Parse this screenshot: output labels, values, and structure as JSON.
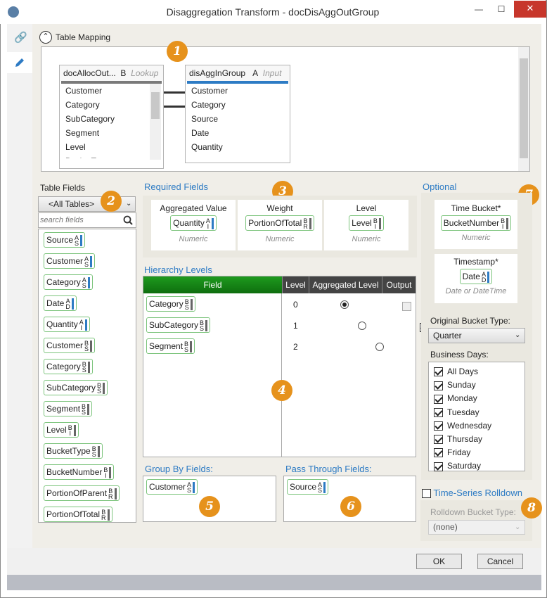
{
  "window": {
    "title": "Disaggregation Transform - docDisAggOutGroup",
    "min": "—",
    "max": "☐",
    "close": "✕"
  },
  "table_mapping": {
    "label": "Table Mapping",
    "left_table": {
      "name": "docAllocOut...",
      "key": "B",
      "role": "Lookup",
      "rows": [
        "Customer",
        "Category",
        "SubCategory",
        "Segment",
        "Level",
        "BucketT..."
      ]
    },
    "right_table": {
      "name": "disAggInGroup",
      "key": "A",
      "role": "Input",
      "rows": [
        "Customer",
        "Category",
        "Source",
        "Date",
        "Quantity"
      ]
    }
  },
  "badges": [
    "1",
    "2",
    "3",
    "4",
    "5",
    "6",
    "7",
    "8"
  ],
  "table_fields": {
    "label": "Table Fields",
    "dropdown": "<All Tables>",
    "search_placeholder": "search fields",
    "items": [
      {
        "name": "Source",
        "t": "A",
        "b": "S",
        "color": "#2d7bc4"
      },
      {
        "name": "Customer",
        "t": "A",
        "b": "S",
        "color": "#2d7bc4"
      },
      {
        "name": "Category",
        "t": "A",
        "b": "S",
        "color": "#2d7bc4"
      },
      {
        "name": "Date",
        "t": "A",
        "b": "D",
        "color": "#2d7bc4"
      },
      {
        "name": "Quantity",
        "t": "A",
        "b": "I",
        "color": "#2d7bc4"
      },
      {
        "name": "Customer",
        "t": "B",
        "b": "S",
        "color": "#666666"
      },
      {
        "name": "Category",
        "t": "B",
        "b": "S",
        "color": "#666666"
      },
      {
        "name": "SubCategory",
        "t": "B",
        "b": "S",
        "color": "#666666"
      },
      {
        "name": "Segment",
        "t": "B",
        "b": "S",
        "color": "#666666"
      },
      {
        "name": "Level",
        "t": "B",
        "b": "I",
        "color": "#666666"
      },
      {
        "name": "BucketType",
        "t": "B",
        "b": "S",
        "color": "#666666"
      },
      {
        "name": "BucketNumber",
        "t": "B",
        "b": "I",
        "color": "#666666"
      },
      {
        "name": "PortionOfParent",
        "t": "B",
        "b": "R",
        "color": "#666666"
      },
      {
        "name": "PortionOfTotal",
        "t": "B",
        "b": "R",
        "color": "#666666"
      }
    ]
  },
  "required": {
    "label": "Required Fields",
    "cols": [
      {
        "title": "Aggregated Value",
        "field": "Quantity",
        "t": "A",
        "b": "I",
        "type": "Numeric"
      },
      {
        "title": "Weight",
        "field": "PortionOfTotal",
        "t": "B",
        "b": "R",
        "type": "Numeric"
      },
      {
        "title": "Level",
        "field": "Level",
        "t": "B",
        "b": "I",
        "type": "Numeric"
      }
    ]
  },
  "hierarchy": {
    "label": "Hierarchy Levels",
    "headers": [
      "Field",
      "Level",
      "Aggregated Level",
      "Output"
    ],
    "rows": [
      {
        "field": "Category",
        "t": "B",
        "b": "S",
        "level": "0",
        "agg": true,
        "output": false
      },
      {
        "field": "SubCategory",
        "t": "B",
        "b": "S",
        "level": "1",
        "agg": false,
        "output": true
      },
      {
        "field": "Segment",
        "t": "B",
        "b": "S",
        "level": "2",
        "agg": false,
        "output": true
      }
    ]
  },
  "group_by": {
    "label": "Group By Fields:",
    "field": "Customer",
    "t": "A",
    "b": "S"
  },
  "pass_through": {
    "label": "Pass Through Fields:",
    "field": "Source",
    "t": "A",
    "b": "S"
  },
  "optional": {
    "label": "Optional",
    "time_bucket": {
      "title": "Time Bucket*",
      "field": "BucketNumber",
      "t": "B",
      "b": "I",
      "type": "Numeric"
    },
    "timestamp": {
      "title": "Timestamp*",
      "field": "Date",
      "t": "A",
      "b": "D",
      "type": "Date or DateTime"
    },
    "bucket_type_label": "Original Bucket Type:",
    "bucket_type_value": "Quarter",
    "business_days_label": "Business Days:",
    "days": [
      "All Days",
      "Sunday",
      "Monday",
      "Tuesday",
      "Wednesday",
      "Thursday",
      "Friday",
      "Saturday"
    ]
  },
  "rolldown": {
    "label": "Time-Series Rolldown",
    "bucket_label": "Rolldown Bucket Type:",
    "bucket_value": "(none)"
  },
  "buttons": {
    "ok": "OK",
    "cancel": "Cancel"
  }
}
